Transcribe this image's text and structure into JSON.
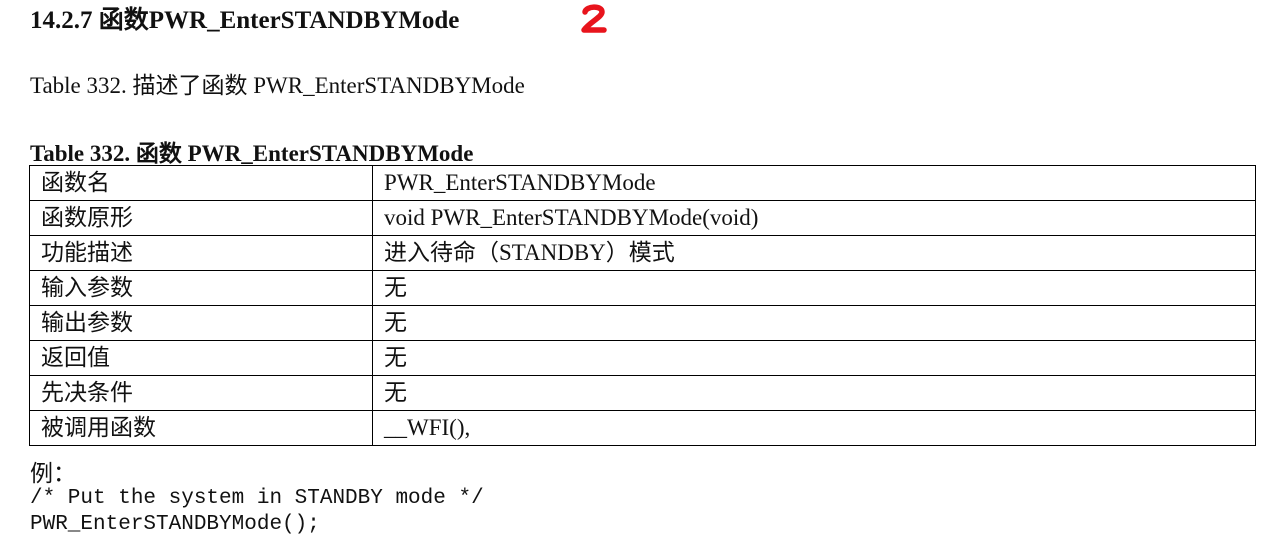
{
  "section": {
    "heading": "14.2.7  函数PWR_EnterSTANDBYMode",
    "annotation_mark": "2",
    "intro": "Table 332.  描述了函数 PWR_EnterSTANDBYMode"
  },
  "table": {
    "caption": "Table 332.  函数 PWR_EnterSTANDBYMode",
    "rows": [
      {
        "label": "函数名",
        "value": "PWR_EnterSTANDBYMode"
      },
      {
        "label": "函数原形",
        "value": "void PWR_EnterSTANDBYMode(void)"
      },
      {
        "label": "功能描述",
        "value": "进入待命（STANDBY）模式"
      },
      {
        "label": "输入参数",
        "value": "无"
      },
      {
        "label": "输出参数",
        "value": "无"
      },
      {
        "label": "返回值",
        "value": "无"
      },
      {
        "label": "先决条件",
        "value": "无"
      },
      {
        "label": "被调用函数",
        "value": "__WFI(),"
      }
    ]
  },
  "example": {
    "label": "例：",
    "code_lines": [
      "/* Put the system in STANDBY mode */",
      "PWR_EnterSTANDBYMode();"
    ]
  },
  "colors": {
    "text": "#111111",
    "border": "#000000",
    "annotation": "#e8141c"
  }
}
